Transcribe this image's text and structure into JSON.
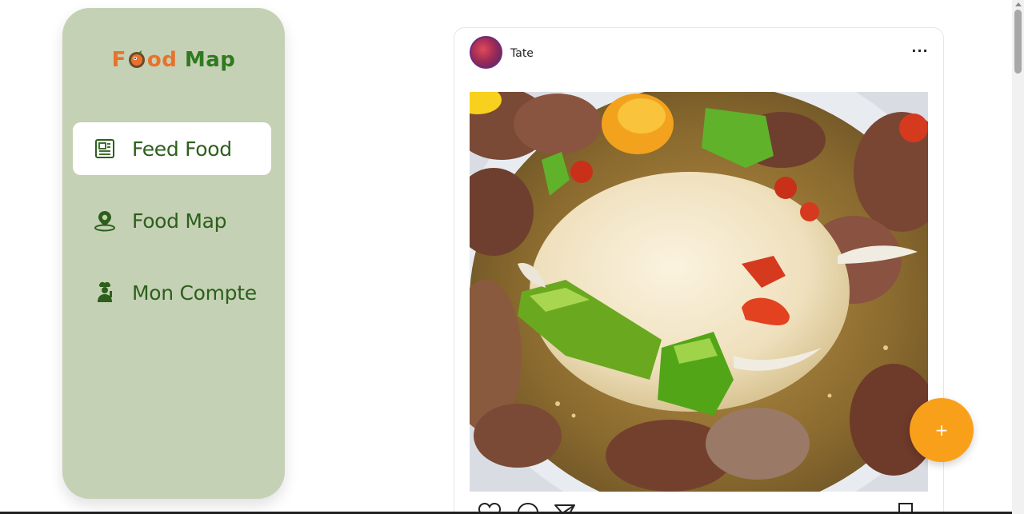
{
  "sidebar": {
    "logo": {
      "part1": "F",
      "part2": "od",
      "part3": "Map"
    },
    "items": [
      {
        "label": "Feed Food",
        "icon": "newspaper-icon",
        "active": true
      },
      {
        "label": "Food Map",
        "icon": "map-pin-icon",
        "active": false
      },
      {
        "label": "Mon Compte",
        "icon": "chef-user-icon",
        "active": false
      }
    ]
  },
  "post": {
    "username": "Tate",
    "more_label": "···",
    "image": "food-dish-photo",
    "actions": [
      "heart-icon",
      "comment-icon",
      "share-icon",
      "bookmark-icon"
    ]
  },
  "fab": {
    "label": "+"
  },
  "colors": {
    "sidebar_bg": "#c5d1b5",
    "nav_text": "#2d5f1c",
    "logo_orange": "#e8722c",
    "logo_green": "#2f7a1f",
    "fab": "#f9a01b"
  }
}
